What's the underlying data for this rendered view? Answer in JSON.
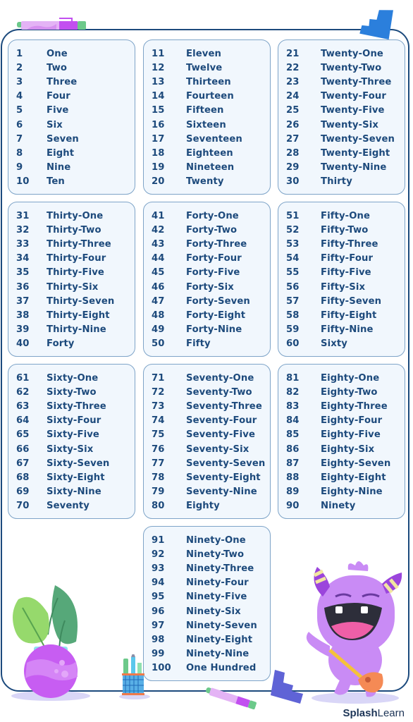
{
  "brand": {
    "bold": "Splash",
    "light": "Learn"
  },
  "cards": [
    {
      "rows": [
        [
          "1",
          "One"
        ],
        [
          "2",
          "Two"
        ],
        [
          "3",
          "Three"
        ],
        [
          "4",
          "Four"
        ],
        [
          "5",
          "Five"
        ],
        [
          "6",
          "Six"
        ],
        [
          "7",
          "Seven"
        ],
        [
          "8",
          "Eight"
        ],
        [
          "9",
          "Nine"
        ],
        [
          "10",
          "Ten"
        ]
      ]
    },
    {
      "rows": [
        [
          "11",
          "Eleven"
        ],
        [
          "12",
          "Twelve"
        ],
        [
          "13",
          "Thirteen"
        ],
        [
          "14",
          "Fourteen"
        ],
        [
          "15",
          "Fifteen"
        ],
        [
          "16",
          "Sixteen"
        ],
        [
          "17",
          "Seventeen"
        ],
        [
          "18",
          "Eighteen"
        ],
        [
          "19",
          "Nineteen"
        ],
        [
          "20",
          "Twenty"
        ]
      ]
    },
    {
      "rows": [
        [
          "21",
          "Twenty-One"
        ],
        [
          "22",
          "Twenty-Two"
        ],
        [
          "23",
          "Twenty-Three"
        ],
        [
          "24",
          "Twenty-Four"
        ],
        [
          "25",
          "Twenty-Five"
        ],
        [
          "26",
          "Twenty-Six"
        ],
        [
          "27",
          "Twenty-Seven"
        ],
        [
          "28",
          "Twenty-Eight"
        ],
        [
          "29",
          "Twenty-Nine"
        ],
        [
          "30",
          "Thirty"
        ]
      ]
    },
    {
      "rows": [
        [
          "31",
          "Thirty-One"
        ],
        [
          "32",
          "Thirty-Two"
        ],
        [
          "33",
          "Thirty-Three"
        ],
        [
          "34",
          "Thirty-Four"
        ],
        [
          "35",
          "Thirty-Five"
        ],
        [
          "36",
          "Thirty-Six"
        ],
        [
          "37",
          "Thirty-Seven"
        ],
        [
          "38",
          "Thirty-Eight"
        ],
        [
          "39",
          "Thirty-Nine"
        ],
        [
          "40",
          "Forty"
        ]
      ]
    },
    {
      "rows": [
        [
          "41",
          "Forty-One"
        ],
        [
          "42",
          "Forty-Two"
        ],
        [
          "43",
          "Forty-Three"
        ],
        [
          "44",
          "Forty-Four"
        ],
        [
          "45",
          "Forty-Five"
        ],
        [
          "46",
          "Forty-Six"
        ],
        [
          "47",
          "Forty-Seven"
        ],
        [
          "48",
          "Forty-Eight"
        ],
        [
          "49",
          "Forty-Nine"
        ],
        [
          "50",
          "Fifty"
        ]
      ]
    },
    {
      "rows": [
        [
          "51",
          "Fifty-One"
        ],
        [
          "52",
          "Fifty-Two"
        ],
        [
          "53",
          "Fifty-Three"
        ],
        [
          "54",
          "Fifty-Four"
        ],
        [
          "55",
          "Fifty-Five"
        ],
        [
          "56",
          "Fifty-Six"
        ],
        [
          "57",
          "Fifty-Seven"
        ],
        [
          "58",
          "Fifty-Eight"
        ],
        [
          "59",
          "Fifty-Nine"
        ],
        [
          "60",
          "Sixty"
        ]
      ]
    },
    {
      "rows": [
        [
          "61",
          "Sixty-One"
        ],
        [
          "62",
          "Sixty-Two"
        ],
        [
          "63",
          "Sixty-Three"
        ],
        [
          "64",
          "Sixty-Four"
        ],
        [
          "65",
          "Sixty-Five"
        ],
        [
          "66",
          "Sixty-Six"
        ],
        [
          "67",
          "Sixty-Seven"
        ],
        [
          "68",
          "Sixty-Eight"
        ],
        [
          "69",
          "Sixty-Nine"
        ],
        [
          "70",
          "Seventy"
        ]
      ]
    },
    {
      "rows": [
        [
          "71",
          "Seventy-One"
        ],
        [
          "72",
          "Seventy-Two"
        ],
        [
          "73",
          "Seventy-Three"
        ],
        [
          "74",
          "Seventy-Four"
        ],
        [
          "75",
          "Seventy-Five"
        ],
        [
          "76",
          "Seventy-Six"
        ],
        [
          "77",
          "Seventy-Seven"
        ],
        [
          "78",
          "Seventy-Eight"
        ],
        [
          "79",
          "Seventy-Nine"
        ],
        [
          "80",
          "Eighty"
        ]
      ]
    },
    {
      "rows": [
        [
          "81",
          "Eighty-One"
        ],
        [
          "82",
          "Eighty-Two"
        ],
        [
          "83",
          "Eighty-Three"
        ],
        [
          "84",
          "Eighty-Four"
        ],
        [
          "85",
          "Eighty-Five"
        ],
        [
          "86",
          "Eighty-Six"
        ],
        [
          "87",
          "Eighty-Seven"
        ],
        [
          "88",
          "Eighty-Eight"
        ],
        [
          "89",
          "Eighty-Nine"
        ],
        [
          "90",
          "Ninety"
        ]
      ]
    },
    {
      "rows": [
        [
          "91",
          "Ninety-One"
        ],
        [
          "92",
          "Ninety-Two"
        ],
        [
          "93",
          "Ninety-Three"
        ],
        [
          "94",
          "Ninety-Four"
        ],
        [
          "95",
          "Ninety-Five"
        ],
        [
          "96",
          "Ninety-Six"
        ],
        [
          "97",
          "Ninety-Seven"
        ],
        [
          "98",
          "Ninety-Eight"
        ],
        [
          "99",
          "Ninety-Nine"
        ],
        [
          "100",
          "One Hundred"
        ]
      ]
    }
  ],
  "colors": {
    "text": "#1d4a7c",
    "card_bg": "#f1f7fd",
    "card_border": "#7ea4c8",
    "frame": "#1c4a7d"
  }
}
